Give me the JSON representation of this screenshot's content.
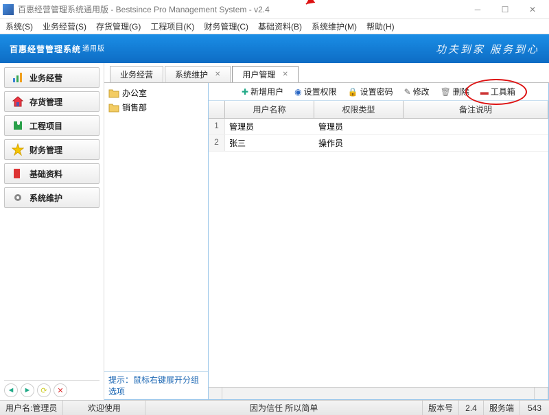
{
  "title": "百惠经营管理系统通用版 - Bestsince Pro Management System - v2.4",
  "menu": {
    "system": "系统(S)",
    "business": "业务经营(S)",
    "stock": "存货管理(G)",
    "project": "工程项目(K)",
    "finance": "财务管理(C)",
    "base": "基础资料(B)",
    "maintain": "系统维护(M)",
    "help": "帮助(H)"
  },
  "banner": {
    "brand": "百惠经营管理系统",
    "sub": "通用版",
    "slogan": "功夫到家  服务到心"
  },
  "sidebar": {
    "items": [
      {
        "label": "业务经营"
      },
      {
        "label": "存货管理"
      },
      {
        "label": "工程项目"
      },
      {
        "label": "财务管理"
      },
      {
        "label": "基础资料"
      },
      {
        "label": "系统维护"
      }
    ]
  },
  "tabs": [
    {
      "label": "业务经营"
    },
    {
      "label": "系统维护"
    },
    {
      "label": "用户管理"
    }
  ],
  "tree": {
    "items": [
      {
        "label": "办公室"
      },
      {
        "label": "销售部"
      }
    ],
    "hint": "提示：鼠标右键展开分组选项"
  },
  "toolbar": {
    "addUser": "新增用户",
    "setPerm": "设置权限",
    "setPwd": "设置密码",
    "edit": "修改",
    "del": "删除",
    "toolbox": "工具箱"
  },
  "grid": {
    "headers": {
      "rownum": "",
      "name": "用户名称",
      "type": "权限类型",
      "remark": "备注说明"
    },
    "rows": [
      {
        "num": "1",
        "name": "管理员",
        "type": "管理员",
        "remark": ""
      },
      {
        "num": "2",
        "name": "张三",
        "type": "操作员",
        "remark": ""
      }
    ]
  },
  "status": {
    "user_label": "用户名:",
    "user": "管理员",
    "welcome": "欢迎使用",
    "center": "因为信任 所以简单",
    "version_label": "版本号",
    "version": "2.4",
    "server_label": "服务端",
    "server": "543"
  }
}
